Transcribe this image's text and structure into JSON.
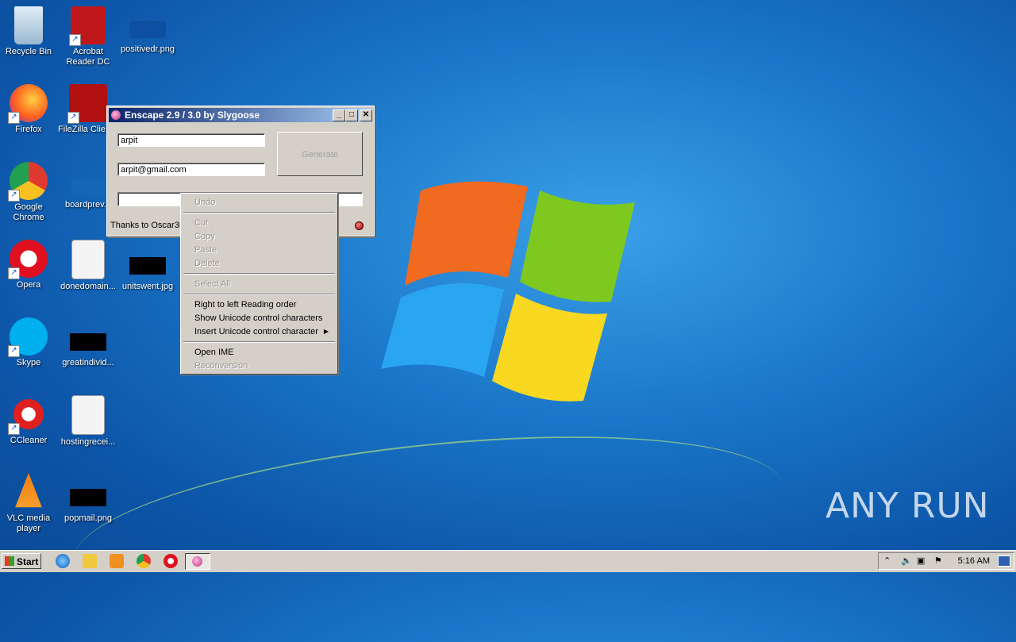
{
  "desktop": {
    "icons": [
      {
        "label": "Recycle Bin"
      },
      {
        "label": "Acrobat Reader DC"
      },
      {
        "label": "positivedr.png"
      },
      {
        "label": "Firefox"
      },
      {
        "label": "FileZilla Client"
      },
      {
        "label": "Google Chrome"
      },
      {
        "label": "boardprev..."
      },
      {
        "label": "Opera"
      },
      {
        "label": "donedomain..."
      },
      {
        "label": "unitswent.jpg"
      },
      {
        "label": "Skype"
      },
      {
        "label": "greatindivid..."
      },
      {
        "label": "CCleaner"
      },
      {
        "label": "hostingrecei..."
      },
      {
        "label": "VLC media player"
      },
      {
        "label": "popmail.png"
      }
    ],
    "watermark": "ANY RUN"
  },
  "window": {
    "title": "Enscape 2.9 / 3.0 by Slygoose",
    "name_value": "arpit",
    "email_value": "arpit@gmail.com",
    "serial_value": "",
    "generate_label": "Generate",
    "status_text": "Thanks to Oscar3D",
    "min_glyph": "_",
    "max_glyph": "□",
    "close_glyph": "✕"
  },
  "context_menu": {
    "items": [
      {
        "label": "Undo",
        "enabled": false
      },
      {
        "label": "Cut",
        "enabled": false
      },
      {
        "label": "Copy",
        "enabled": false
      },
      {
        "label": "Paste",
        "enabled": false
      },
      {
        "label": "Delete",
        "enabled": false
      },
      {
        "label": "Select All",
        "enabled": false
      },
      {
        "label": "Right to left Reading order",
        "enabled": true
      },
      {
        "label": "Show Unicode control characters",
        "enabled": true
      },
      {
        "label": "Insert Unicode control character",
        "enabled": true
      },
      {
        "label": "Open IME",
        "enabled": true
      },
      {
        "label": "Reconversion",
        "enabled": false
      }
    ],
    "submenu_arrow": "▶"
  },
  "taskbar": {
    "start_label": "Start",
    "clock": "5:16 AM",
    "tray_expand": "⌃"
  },
  "colors": {
    "desktop": "#1a76c8",
    "titlebar_start": "#0a246a",
    "titlebar_end": "#a6caf0",
    "face": "#d4d0c8"
  }
}
